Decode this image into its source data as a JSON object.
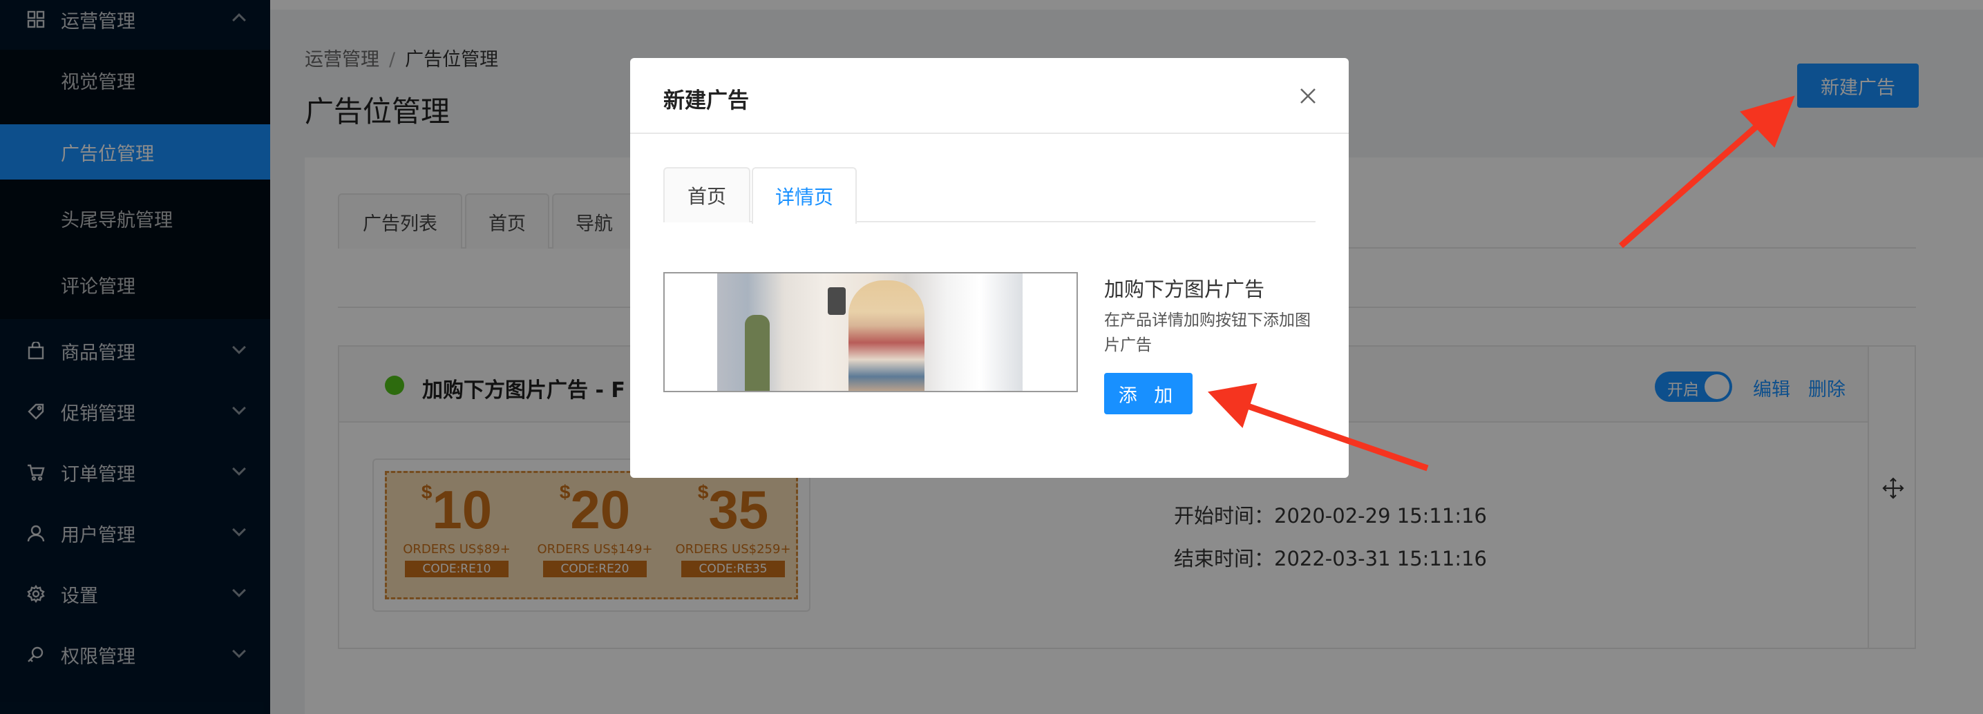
{
  "sidebar": {
    "groups": [
      {
        "label": "运营管理",
        "icon": "grid-icon",
        "expanded": true
      },
      {
        "label": "商品管理",
        "icon": "bag-icon"
      },
      {
        "label": "促销管理",
        "icon": "tag-icon"
      },
      {
        "label": "订单管理",
        "icon": "cart-icon"
      },
      {
        "label": "用户管理",
        "icon": "user-icon"
      },
      {
        "label": "设置",
        "icon": "gear-icon"
      },
      {
        "label": "权限管理",
        "icon": "key-icon"
      }
    ],
    "submenu": [
      {
        "label": "视觉管理"
      },
      {
        "label": "广告位管理",
        "active": true
      },
      {
        "label": "头尾导航管理"
      },
      {
        "label": "评论管理"
      }
    ]
  },
  "breadcrumb": {
    "parent": "运营管理",
    "separator": "/",
    "current": "广告位管理"
  },
  "page_title": "广告位管理",
  "new_ad_button": "新建广告",
  "tabs": [
    "广告列表",
    "首页",
    "导航"
  ],
  "ad_card": {
    "name": "加购下方图片广告 - F",
    "status_color": "#52c41a",
    "toggle_label": "开启",
    "toggle_on": true,
    "edit_label": "编辑",
    "delete_label": "删除",
    "drag_icon": "move-icon",
    "start_time": "开始时间：2020-02-29 15:11:16",
    "end_time": "结束时间：2022-03-31 15:11:16",
    "coupons": [
      {
        "amount": "10",
        "currency": "$",
        "orders": "ORDERS US$89+",
        "code": "CODE:RE10"
      },
      {
        "amount": "20",
        "currency": "$",
        "orders": "ORDERS US$149+",
        "code": "CODE:RE20"
      },
      {
        "amount": "35",
        "currency": "$",
        "orders": "ORDERS US$259+",
        "code": "CODE:RE35"
      }
    ]
  },
  "modal": {
    "title": "新建广告",
    "close_icon": "close-icon",
    "tabs": [
      {
        "label": "首页",
        "active": false
      },
      {
        "label": "详情页",
        "active": true
      }
    ],
    "ad_option": {
      "title": "加购下方图片广告",
      "description": "在产品详情加购按钮下添加图片广告",
      "add_button": "添 加"
    }
  },
  "colors": {
    "primary": "#1890ff",
    "sidebar_bg": "#001529",
    "annotation_arrow": "#f5341f"
  }
}
